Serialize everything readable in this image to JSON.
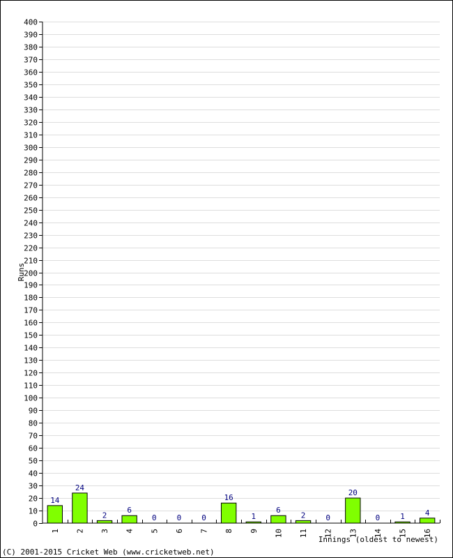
{
  "copyright": "(C) 2001-2015 Cricket Web (www.cricketweb.net)",
  "colors": {
    "bar_fill": "#80ff00",
    "bar_stroke": "#000000",
    "value_label": "#00007f",
    "grid": "#dddddd"
  },
  "chart_data": {
    "type": "bar",
    "title": "",
    "xlabel": "Innings (oldest to newest)",
    "ylabel": "Runs",
    "ylim": [
      0,
      400
    ],
    "ytick_step": 10,
    "grid": true,
    "categories": [
      "1",
      "2",
      "3",
      "4",
      "5",
      "6",
      "7",
      "8",
      "9",
      "10",
      "11",
      "12",
      "13",
      "14",
      "15",
      "16"
    ],
    "values": [
      14,
      24,
      2,
      6,
      0,
      0,
      0,
      16,
      1,
      6,
      2,
      0,
      20,
      0,
      1,
      4
    ]
  }
}
